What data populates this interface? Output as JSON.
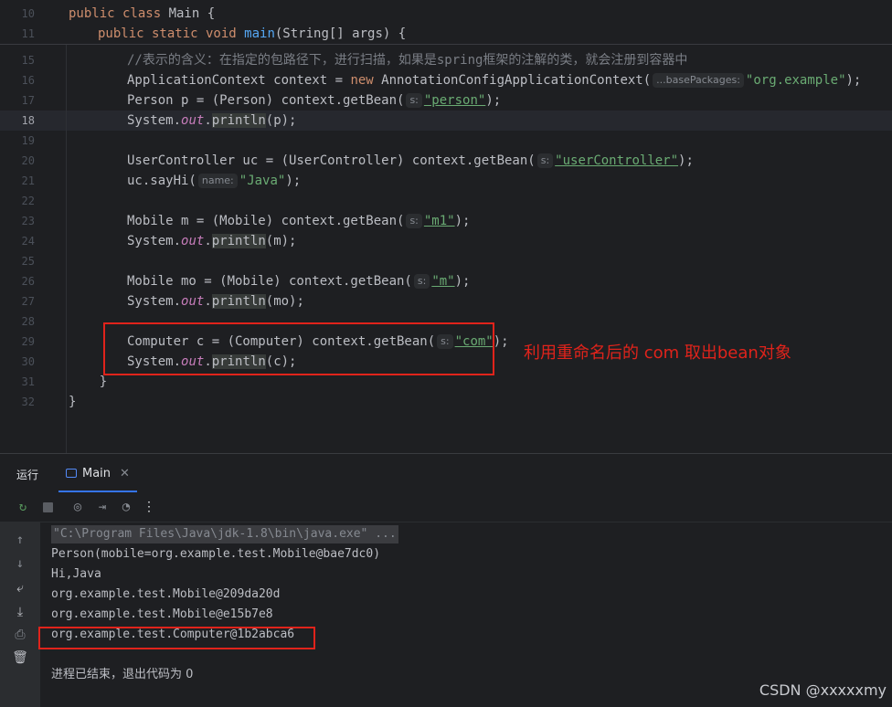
{
  "sticky_lines": [
    {
      "num": "10",
      "code": "public class Main {"
    },
    {
      "num": "11",
      "code": "    public static void main(String[] args) {"
    }
  ],
  "editor": {
    "l15": {
      "num": "15",
      "comment": "//表示的含义：在指定的包路径下，进行扫描，如果是spring框架的注解的类，就会注册到容器中"
    },
    "l16": {
      "num": "16",
      "a": "ApplicationContext context = ",
      "kw": "new",
      "b": " AnnotationConfigApplicationContext(",
      "hint": "...basePackages:",
      "str": "\"org.example\"",
      "c": ");"
    },
    "l17": {
      "num": "17",
      "a": "Person p = (Person) context.getBean(",
      "hint": "s:",
      "str": "\"person\"",
      "c": ");"
    },
    "l18": {
      "num": "18",
      "a": "System.",
      "out": "out",
      "b": ".",
      "fn": "println",
      "c": "(p);"
    },
    "l19": {
      "num": "19"
    },
    "l20": {
      "num": "20",
      "a": "UserController uc = (UserController) context.getBean(",
      "hint": "s:",
      "str": "\"userController\"",
      "c": ");"
    },
    "l21": {
      "num": "21",
      "a": "uc.sayHi(",
      "hint": "name:",
      "str": "\"Java\"",
      "c": ");"
    },
    "l22": {
      "num": "22"
    },
    "l23": {
      "num": "23",
      "a": "Mobile m = (Mobile) context.getBean(",
      "hint": "s:",
      "str": "\"m1\"",
      "c": ");"
    },
    "l24": {
      "num": "24",
      "a": "System.",
      "out": "out",
      "b": ".",
      "fn": "println",
      "c": "(m);"
    },
    "l25": {
      "num": "25"
    },
    "l26": {
      "num": "26",
      "a": "Mobile mo = (Mobile) context.getBean(",
      "hint": "s:",
      "str": "\"m\"",
      "c": ");"
    },
    "l27": {
      "num": "27",
      "a": "System.",
      "out": "out",
      "b": ".",
      "fn": "println",
      "c": "(mo);"
    },
    "l28": {
      "num": "28"
    },
    "l29": {
      "num": "29",
      "a": "Computer c = (Computer) context.getBean(",
      "hint": "s:",
      "str": "\"com\"",
      "c": ");"
    },
    "l30": {
      "num": "30",
      "a": "System.",
      "out": "out",
      "b": ".",
      "fn": "println",
      "c": "(c);"
    },
    "l31": {
      "num": "31",
      "code": "    }"
    },
    "l32": {
      "num": "32",
      "code": "}"
    }
  },
  "annotation": "利用重命名后的 com 取出bean对象",
  "run_panel": {
    "title": "运行",
    "tab_label": "Main",
    "output": [
      "\"C:\\Program Files\\Java\\jdk-1.8\\bin\\java.exe\" ...",
      "Person(mobile=org.example.test.Mobile@bae7dc0)",
      "Hi,Java",
      "org.example.test.Mobile@209da20d",
      "org.example.test.Mobile@e15b7e8",
      "org.example.test.Computer@1b2abca6",
      "",
      "进程已结束，退出代码为 0"
    ]
  },
  "watermark": "CSDN @xxxxxmy",
  "icons": [
    "rerun-icon",
    "stop-icon",
    "camera-icon",
    "import-icon",
    "gauge-icon",
    "more-icon",
    "up-arrow-icon",
    "down-arrow-icon",
    "wrap-icon",
    "scroll-to-end-icon",
    "print-icon",
    "trash-icon"
  ],
  "colors": {
    "annotation_red": "#e0231b",
    "accent_blue": "#3574f0",
    "keyword": "#cf8e6d",
    "string": "#6aab73",
    "function": "#56a8f5",
    "static_field": "#c77dbb"
  }
}
